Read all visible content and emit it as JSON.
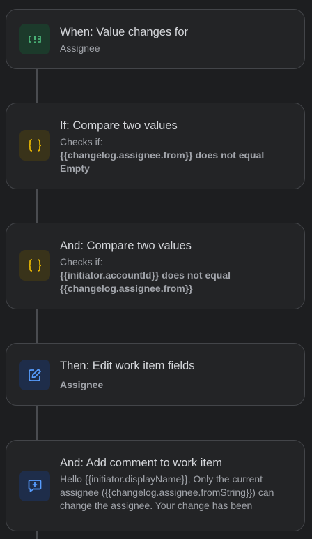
{
  "colors": {
    "background": "#1d1e20",
    "card_background": "#232426",
    "card_border": "#434549",
    "trigger_icon": "#4fbf7f",
    "condition_icon": "#e2b203",
    "action_icon": "#579dff"
  },
  "steps": [
    {
      "type": "trigger",
      "icon": "trigger-icon",
      "title": "When: Value changes for",
      "detail": "Assignee"
    },
    {
      "type": "condition",
      "icon": "curly-braces-icon",
      "title": "If: Compare two values",
      "checks_label": "Checks if:",
      "expression": "{{changelog.assignee.from}} does not equal Empty"
    },
    {
      "type": "condition",
      "icon": "curly-braces-icon",
      "title": "And: Compare two values",
      "checks_label": "Checks if:",
      "expression": "{{initiator.accountId}} does not equal {{changelog.assignee.from}}"
    },
    {
      "type": "action",
      "icon": "edit-icon",
      "title": "Then: Edit work item fields",
      "detail": "Assignee"
    },
    {
      "type": "action",
      "icon": "comment-add-icon",
      "title": "And: Add comment to work item",
      "detail": "Hello {{initiator.displayName}}, Only the current assignee ({{changelog.assignee.fromString}}) can change the assignee. Your change has been"
    }
  ]
}
